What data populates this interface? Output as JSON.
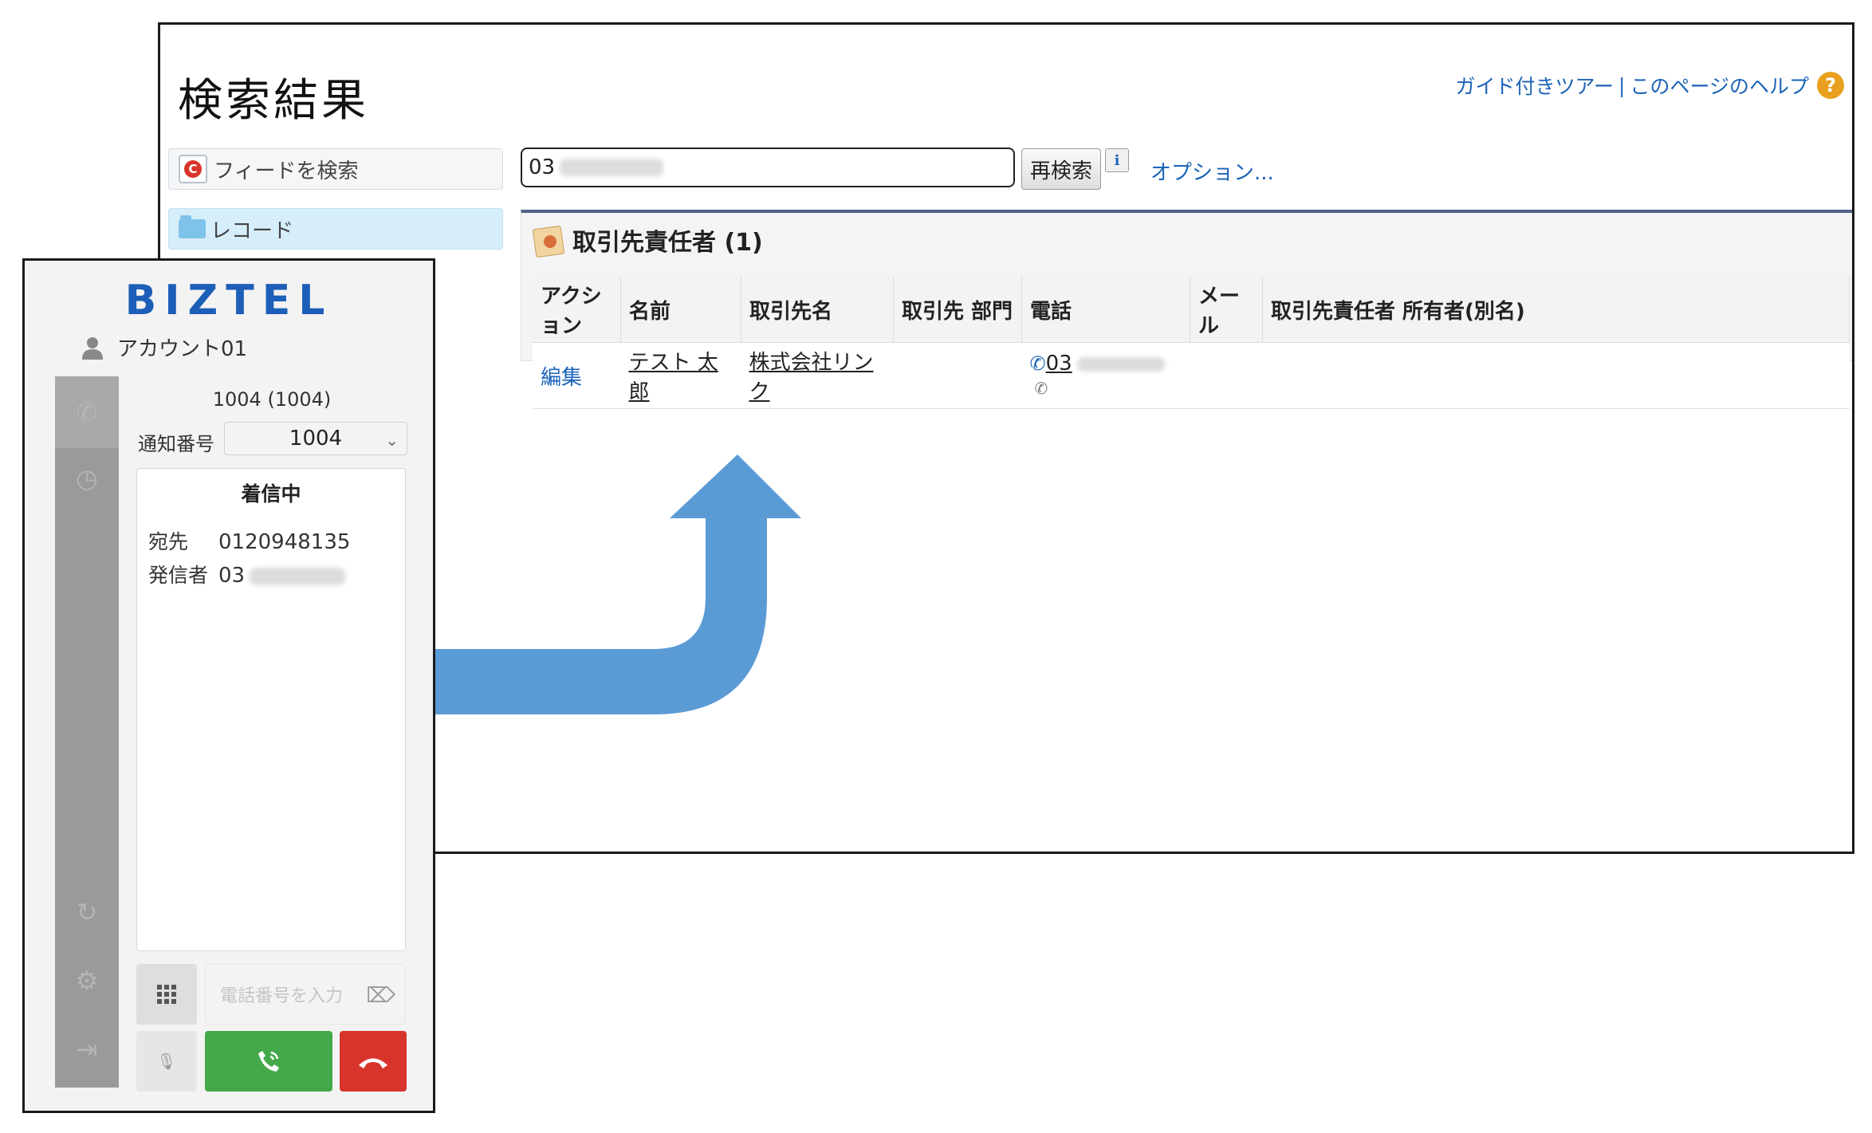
{
  "salesforce": {
    "title": "検索結果",
    "help": {
      "guided_tour": "ガイド付きツアー",
      "separator": "|",
      "page_help": "このページのヘルプ",
      "icon_glyph": "?"
    },
    "sidebar": {
      "feed_search": "フィードを検索",
      "feed_icon_glyph": "C",
      "records": "レコード"
    },
    "search": {
      "value_prefix": "03",
      "research_button": "再検索",
      "info_glyph": "i",
      "options_link": "オプション..."
    },
    "result_section": {
      "title": "取引先責任者 (1)",
      "columns": [
        "アクション",
        "名前",
        "取引先名",
        "取引先 部門",
        "電話",
        "メール",
        "取引先責任者 所有者(別名)"
      ],
      "rows": [
        {
          "action": "編集",
          "name": "テスト 太郎",
          "account": "株式会社リンク",
          "department": "",
          "phone_prefix": "03",
          "email": "",
          "owner": ""
        }
      ]
    }
  },
  "biztel": {
    "logo": "BIZTEL",
    "account": "アカウント01",
    "extension": "1004 (1004)",
    "notify_label": "通知番号",
    "notify_value": "1004",
    "status": "着信中",
    "destination_label": "宛先",
    "destination_value": "0120948135",
    "caller_label": "発信者",
    "caller_prefix": "03",
    "number_input_placeholder": "電話番号を入力"
  },
  "colors": {
    "arrow": "#5b9bd5",
    "brand_blue": "#1d5fb8",
    "answer_green": "#45a84a",
    "hangup_red": "#d7352c",
    "link_blue": "#1b63b8",
    "panel_border": "#52618a"
  },
  "icons": {
    "phone": "phone-icon",
    "history": "history-icon",
    "sync": "sync-icon",
    "settings": "gear-icon",
    "logout": "logout-icon",
    "keypad": "keypad-icon",
    "mic": "mic-icon",
    "answer": "answer-call-icon",
    "hangup": "hangup-icon",
    "backspace": "backspace-icon",
    "user": "user-icon",
    "folder": "folder-icon",
    "contact": "contact-icon"
  }
}
